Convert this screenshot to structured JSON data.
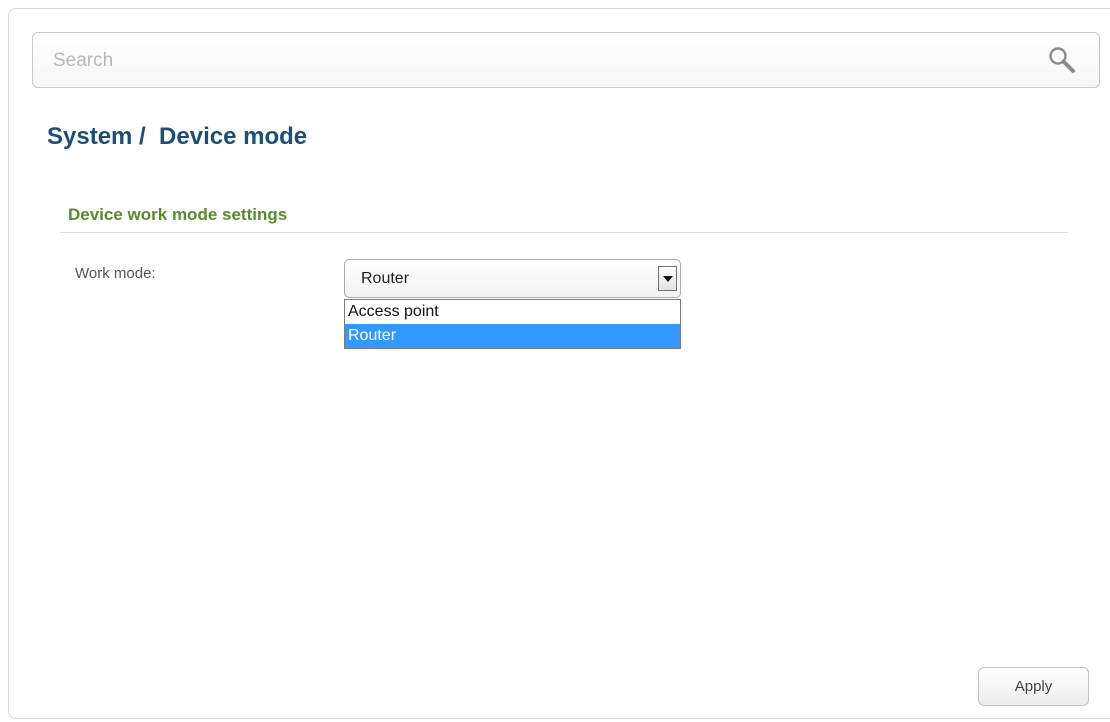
{
  "search": {
    "placeholder": "Search",
    "value": "",
    "icon": "search-icon"
  },
  "breadcrumb": {
    "title": "System /  Device mode"
  },
  "section": {
    "title": "Device work mode settings"
  },
  "work_mode": {
    "label": "Work mode:",
    "value": "Router",
    "options": [
      {
        "label": "Access point",
        "selected": false
      },
      {
        "label": "Router",
        "selected": true
      }
    ]
  },
  "actions": {
    "apply_label": "Apply"
  },
  "colors": {
    "title": "#1d4f73",
    "section_title": "#5b8a2d",
    "selected_option": "#3399ff"
  }
}
